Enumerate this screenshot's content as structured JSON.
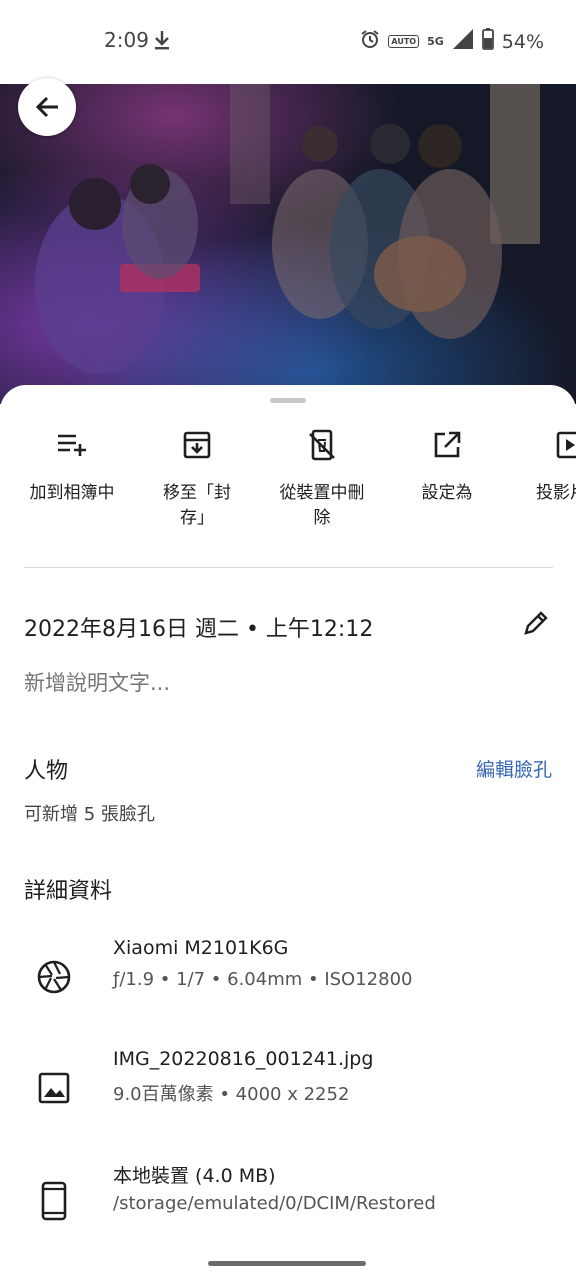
{
  "status_bar": {
    "time": "2:09",
    "battery": "54%",
    "auto_badge": "AUTO",
    "network": "5G"
  },
  "photo": {
    "description_icon": "photo-preview"
  },
  "actions": [
    {
      "label": "加到相簿中",
      "icon": "playlist-add-icon"
    },
    {
      "label": "移至「封存」",
      "icon": "archive-icon"
    },
    {
      "label": "從裝置中刪除",
      "icon": "delete-from-device-icon"
    },
    {
      "label": "設定為",
      "icon": "open-in-new-icon"
    },
    {
      "label": "投影片",
      "icon": "slideshow-icon"
    }
  ],
  "info": {
    "datetime": "2022年8月16日 週二 • 上午12:12",
    "caption_placeholder": "新增說明文字..."
  },
  "people": {
    "title": "人物",
    "edit_label": "編輯臉孔",
    "subtitle": "可新增 5 張臉孔"
  },
  "details": {
    "title": "詳細資料",
    "camera": {
      "model": "Xiaomi M2101K6G",
      "specs": "ƒ/1.9  •  1/7  •  6.04mm  •  ISO12800"
    },
    "file": {
      "name": "IMG_20220816_001241.jpg",
      "specs": "9.0百萬像素  •  4000 x 2252"
    },
    "storage": {
      "location": "本地裝置 (4.0 MB)",
      "path": "/storage/emulated/0/DCIM/Restored"
    }
  },
  "colors": {
    "accent": "#3a67b5",
    "text": "#1f1f1f",
    "muted": "#757575"
  }
}
